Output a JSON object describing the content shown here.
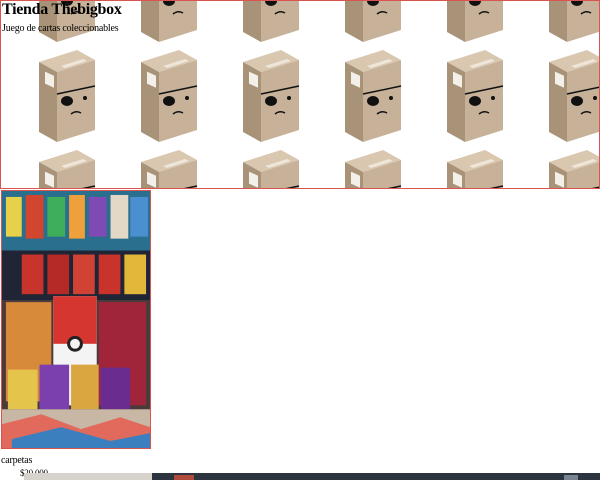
{
  "store": {
    "title": "Tienda Thebigbox",
    "subtitle": "Juego de cartas coleccionables"
  },
  "hero": {
    "pattern_icon": "cardboard-box-eyepatch-icon",
    "rows": 3,
    "columns": 6
  },
  "product": {
    "name": "carpetas",
    "price": "$20.000",
    "image_icon": "pokemon-binders-photo"
  },
  "colors": {
    "accent_border": "#d9534f",
    "box_tan": "#c7b299",
    "box_dark": "#a89378"
  }
}
